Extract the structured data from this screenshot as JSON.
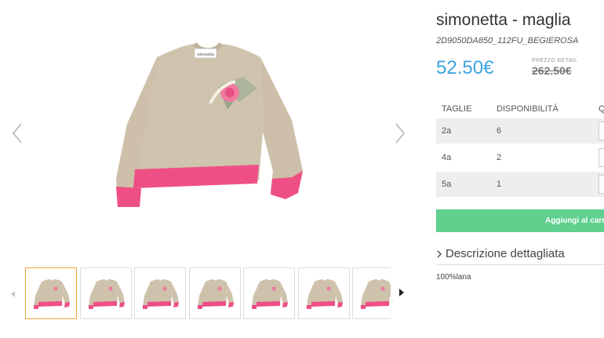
{
  "product": {
    "title": "simonetta - maglia",
    "sku": "2D9050DA850_112FU_BEGIEROSA",
    "price": "52.50€",
    "retail_label": "PREZZO RETAIL",
    "retail_price": "262.50€",
    "image_label": "simonetta",
    "colors": {
      "body": "#cfc2ac",
      "body_dark": "#b9ab94",
      "trim": "#ee4f84",
      "flower": "#f07aa0",
      "price": "#3ca3e0",
      "cart": "#5fd08e",
      "thumb_active": "#f2a33a"
    }
  },
  "sizes_table": {
    "headers": [
      "TAGLIE",
      "DISPONIBILITÀ",
      "Q"
    ],
    "rows": [
      {
        "size": "2a",
        "availability": "6"
      },
      {
        "size": "4a",
        "availability": "2"
      },
      {
        "size": "5a",
        "availability": "1"
      }
    ]
  },
  "cart_button": {
    "label": "Aggiungi al carrello"
  },
  "description": {
    "toggle_label": "Descrizione dettagliata",
    "text": "100%lana"
  },
  "gallery": {
    "thumb_count": 7,
    "active_index": 0
  }
}
